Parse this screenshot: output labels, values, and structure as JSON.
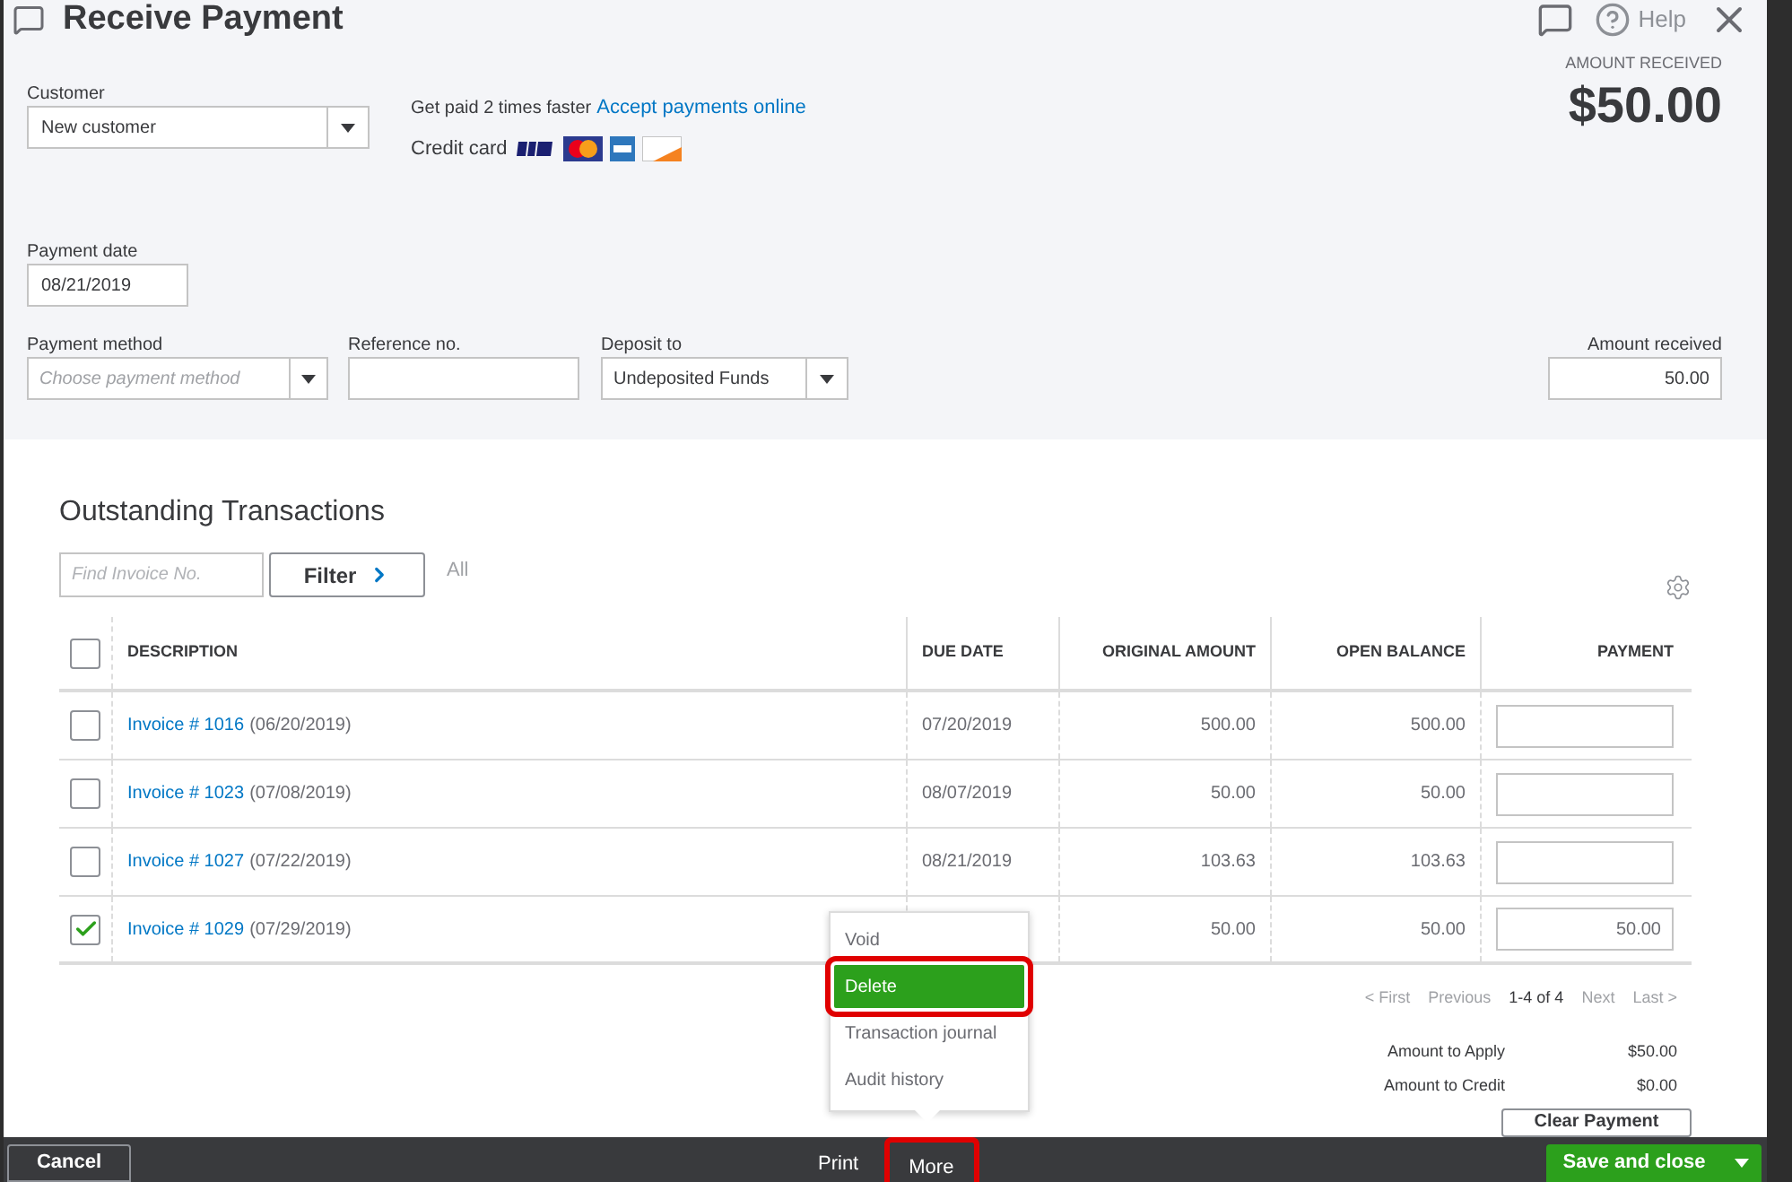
{
  "window": {
    "title": "Receive Payment",
    "help": "Help"
  },
  "header": {
    "customer": {
      "label": "Customer",
      "value": "New customer"
    },
    "promo": {
      "text": "Get paid 2 times faster",
      "link": "Accept payments online",
      "cards_label": "Credit card"
    },
    "amount_received": {
      "label": "AMOUNT RECEIVED",
      "value": "$50.00"
    },
    "payment_date": {
      "label": "Payment date",
      "value": "08/21/2019"
    },
    "payment_method": {
      "label": "Payment method",
      "placeholder": "Choose payment method"
    },
    "reference": {
      "label": "Reference no."
    },
    "deposit_to": {
      "label": "Deposit to",
      "value": "Undeposited Funds"
    },
    "amount_field": {
      "label": "Amount received",
      "value": "50.00"
    }
  },
  "transactions": {
    "title": "Outstanding Transactions",
    "search": {
      "placeholder": "Find Invoice No."
    },
    "filter": "Filter",
    "filter_value": "All",
    "columns": [
      "DESCRIPTION",
      "DUE DATE",
      "ORIGINAL AMOUNT",
      "OPEN BALANCE",
      "PAYMENT"
    ],
    "header_checked": false,
    "rows": [
      {
        "checked": false,
        "invoice": "Invoice # 1016",
        "date": "(06/20/2019)",
        "due_date": "07/20/2019",
        "original": "500.00",
        "balance": "500.00"
      },
      {
        "checked": false,
        "invoice": "Invoice # 1023",
        "date": "(07/08/2019)",
        "due_date": "08/07/2019",
        "original": "50.00",
        "balance": "50.00"
      },
      {
        "checked": false,
        "invoice": "Invoice # 1027",
        "date": "(07/22/2019)",
        "due_date": "08/21/2019",
        "original": "103.63",
        "balance": "103.63"
      },
      {
        "checked": true,
        "invoice": "Invoice # 1029",
        "date": "(07/29/2019)",
        "original": "50.00",
        "balance": "50.00",
        "payment": "50.00"
      }
    ],
    "pagination": {
      "first": "< First",
      "previous": "Previous",
      "range": "1-4 of 4",
      "next": "Next",
      "last": "Last >"
    },
    "totals": [
      {
        "label": "Amount to Apply",
        "value": "$50.00"
      },
      {
        "label": "Amount to Credit",
        "value": "$0.00"
      }
    ],
    "clear_button": "Clear Payment"
  },
  "more_menu": [
    {
      "label": "Void",
      "selected": false,
      "highlighted": false
    },
    {
      "label": "Delete",
      "selected": true,
      "highlighted": true
    },
    {
      "label": "Transaction journal",
      "selected": false,
      "highlighted": false
    },
    {
      "label": "Audit history",
      "selected": false,
      "highlighted": false
    }
  ],
  "footer": {
    "cancel": "Cancel",
    "print": "Print",
    "more": {
      "label": "More",
      "highlighted": true
    },
    "save": "Save and close"
  }
}
